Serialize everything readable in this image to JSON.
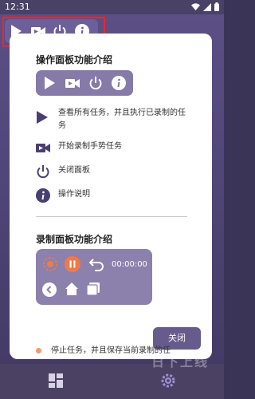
{
  "status_bar": {
    "time": "12:31"
  },
  "dialog": {
    "section1_title": "操作面板功能介绍",
    "features": [
      {
        "icon": "play-icon",
        "text": "查看所有任务，并且执行已录制的任务"
      },
      {
        "icon": "video-record-icon",
        "text": "开始录制手势任务"
      },
      {
        "icon": "power-icon",
        "text": "关闭面板"
      },
      {
        "icon": "info-icon",
        "text": "操作说明"
      }
    ],
    "section2_title": "录制面板功能介绍",
    "record_timer": "00:00:00",
    "partial_text": "停止任务，并且保存当前录制的任",
    "close_button": "关闭"
  },
  "watermark": "日下上线",
  "colors": {
    "accent": "#6d5f9a",
    "highlight": "#e8282b",
    "record_orange": "#f07a4a"
  }
}
